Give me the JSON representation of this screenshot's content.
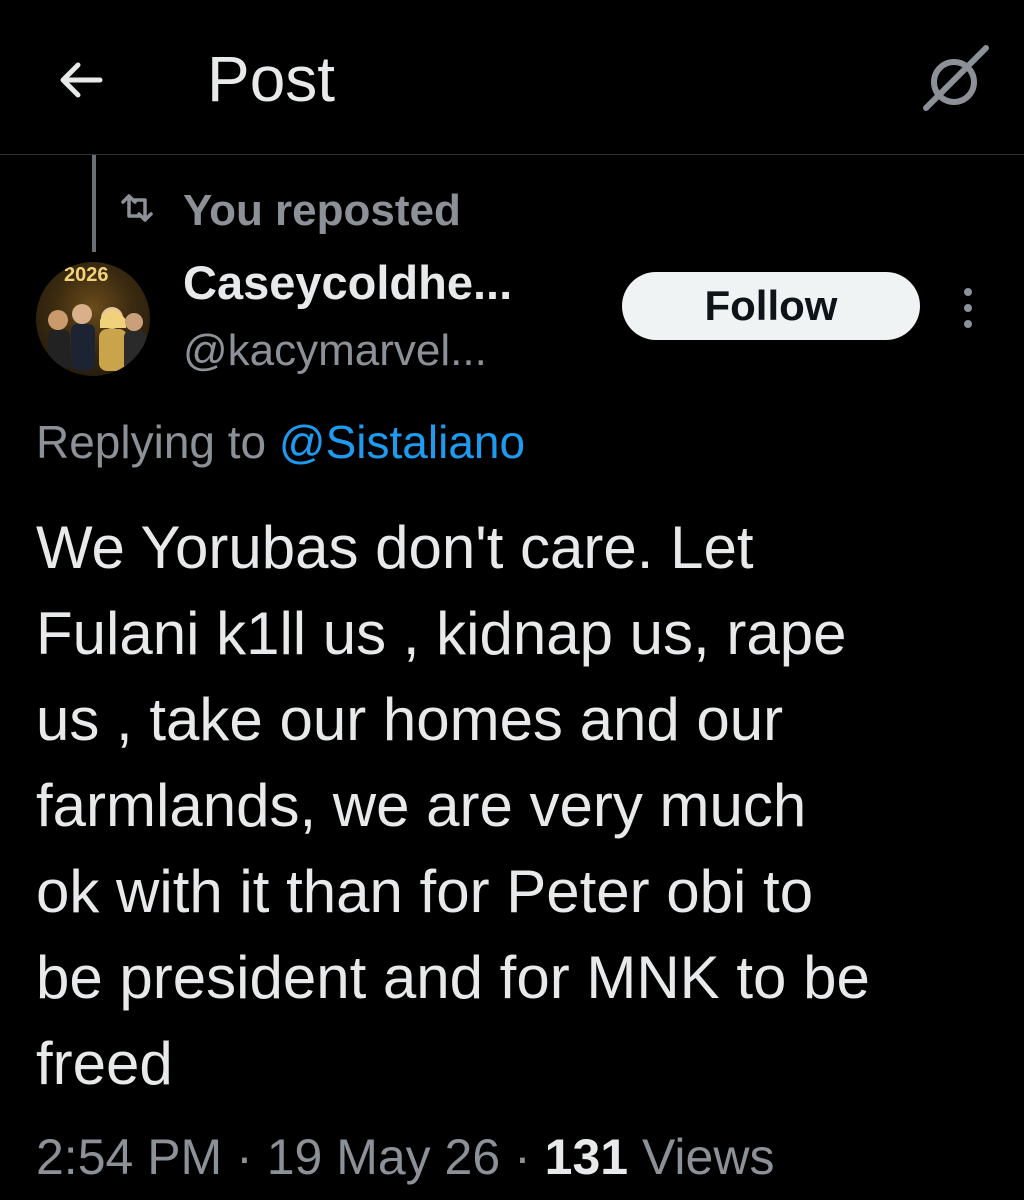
{
  "header": {
    "back_icon": "arrow-left-icon",
    "title": "Post",
    "grok_icon": "grok-icon"
  },
  "repost": {
    "icon": "repost-icon",
    "label": "You reposted"
  },
  "author": {
    "avatar_text": "2026",
    "display_name": "Caseycoldhe...",
    "handle": "@kacymarvel..."
  },
  "actions": {
    "follow_label": "Follow",
    "more_icon": "more-vertical-icon"
  },
  "reply": {
    "prefix": "Replying to ",
    "mention": "@Sistaliano"
  },
  "post": {
    "text": "We Yorubas don't care. Let\nFulani k1ll us , kidnap us, rape\nus , take our homes and our\nfarmlands, we are very much\nok with it than for Peter obi to\nbe president and for MNK to be\nfreed"
  },
  "meta": {
    "time": "2:54 PM",
    "date": "19 May 26",
    "separator": "·",
    "views_count": "131",
    "views_label": "Views"
  },
  "colors": {
    "background": "#000000",
    "text": "#e7e9ea",
    "secondary": "#8b9196",
    "link": "#1d9bf0",
    "button_bg": "#eff3f4"
  }
}
